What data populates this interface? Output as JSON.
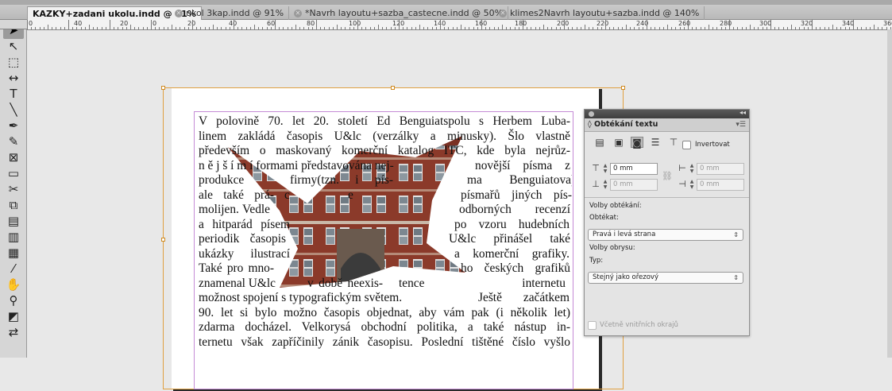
{
  "tabs": [
    {
      "label": "KAZKY+zadani ukolu.indd @ 91%",
      "active": true
    },
    {
      "label": "ukol 3kap.indd @ 91%",
      "active": false
    },
    {
      "label": "*Navrh layoutu+sazba_castecne.indd @ 50%",
      "active": false
    },
    {
      "label": "klimes2Navrh layoutu+sazba.indd @ 140%",
      "active": false
    }
  ],
  "ruler_labels": [
    "0",
    "40",
    "20",
    "0",
    "20",
    "40",
    "60",
    "80",
    "100",
    "120",
    "140",
    "160",
    "180",
    "200",
    "220",
    "240",
    "260",
    "280",
    "300",
    "320",
    "340",
    "360"
  ],
  "tools": [
    {
      "name": "selection-tool-icon",
      "glyph": "➤",
      "selected": true
    },
    {
      "name": "direct-selection-tool-icon",
      "glyph": "↖"
    },
    {
      "name": "page-tool-icon",
      "glyph": "⬚"
    },
    {
      "name": "gap-tool-icon",
      "glyph": "↔"
    },
    {
      "name": "type-tool-icon",
      "glyph": "T"
    },
    {
      "name": "line-tool-icon",
      "glyph": "╲"
    },
    {
      "name": "pen-tool-icon",
      "glyph": "✒"
    },
    {
      "name": "pencil-tool-icon",
      "glyph": "✎"
    },
    {
      "name": "rectangle-frame-tool-icon",
      "glyph": "⊠"
    },
    {
      "name": "rectangle-tool-icon",
      "glyph": "▭"
    },
    {
      "name": "scissors-tool-icon",
      "glyph": "✂"
    },
    {
      "name": "free-transform-tool-icon",
      "glyph": "⧉"
    },
    {
      "name": "gradient-swatch-tool-icon",
      "glyph": "▤"
    },
    {
      "name": "gradient-feather-tool-icon",
      "glyph": "▥"
    },
    {
      "name": "note-tool-icon",
      "glyph": "▦"
    },
    {
      "name": "eyedropper-tool-icon",
      "glyph": "⁄"
    },
    {
      "name": "hand-tool-icon",
      "glyph": "✋"
    },
    {
      "name": "zoom-tool-icon",
      "glyph": "⚲"
    },
    {
      "name": "fill-stroke-icon",
      "glyph": "◩"
    },
    {
      "name": "swap-colors-icon",
      "glyph": "⇄"
    }
  ],
  "body_text": [
    [
      "V polovině 70. let 20. století Ed Benguiatspolu s Herbem Luba-"
    ],
    [
      "linem zakládá časopis U&lc (verzálky a minusky). Šlo vlastně"
    ],
    [
      "především o maskovaný komerční katalog ITC, kde byla nejrůz-"
    ],
    [
      "n ě j š í m í  formami   představována   nej-",
      "novější písma z"
    ],
    [
      "produkce",
      "firmy(tzn.  i  pís-",
      "ma Benguiatova),"
    ],
    [
      "ale také prá-",
      "c",
      "e",
      "písmařů jiných pís-"
    ],
    [
      "molijen. Vedle",
      "odborných  recenzí"
    ],
    [
      "a hitparád písem",
      "po vzoru hudebních"
    ],
    [
      "periodik   časopis",
      "U&lc  přinášel  také"
    ],
    [
      "ukázky  ilustrací",
      "a  komerční grafiky."
    ],
    [
      "Také  pro  mno-",
      "ho českých grafiků"
    ],
    [
      "znamenal  U&lc",
      "v době neexis-",
      "tence   internetu"
    ],
    [
      "možnost spojení s typografickým světem.",
      "Ještě  začátkem"
    ],
    [
      "90. let si bylo možno časopis objednat, aby vám pak (i několik let)"
    ],
    [
      "zdarma docházel. Velkorysá obchodní politika, a také nástup in-"
    ],
    [
      "ternetu však zapříčinily zánik časopisu. Poslední tištěné číslo vyšlo"
    ]
  ],
  "panel": {
    "title": "Obtékání textu",
    "invert_label": "Invertovat",
    "offset_top": "0 mm",
    "offset_bottom": "0 mm",
    "offset_left": "0 mm",
    "offset_right": "0 mm",
    "wrap_options_label": "Volby obtékání:",
    "wrap_to_label": "Obtékat:",
    "wrap_to_value": "Pravá i levá strana",
    "contour_options_label": "Volby obrysu:",
    "type_label": "Typ:",
    "type_value": "Stejný jako ořezový",
    "include_inside_label": "Včetně vnitřních okrajů"
  },
  "colors": {
    "frame_selection": "#e0a040",
    "text_frame": "#c58bd6",
    "brick": "#8b3a2a"
  }
}
